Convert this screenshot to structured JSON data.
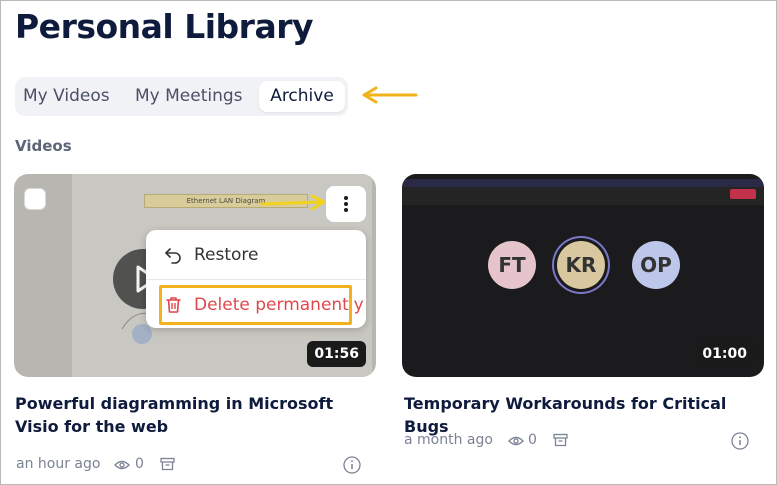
{
  "page": {
    "title": "Personal Library",
    "section_label": "Videos"
  },
  "tabs": [
    {
      "label": "My Videos",
      "active": false
    },
    {
      "label": "My Meetings",
      "active": false
    },
    {
      "label": "Archive",
      "active": true
    }
  ],
  "videos": [
    {
      "title": "Powerful diagramming in Microsoft Visio for the web",
      "duration": "01:56",
      "time_ago": "an hour ago",
      "views": "0",
      "slide_banner": "Ethernet LAN Diagram"
    },
    {
      "title": "Temporary Workarounds for Critical Bugs",
      "duration": "01:00",
      "time_ago": "a month ago",
      "views": "0",
      "participants": [
        {
          "initials": "FT",
          "color": "#e6c4cc"
        },
        {
          "initials": "KR",
          "color": "#d9c89f"
        },
        {
          "initials": "OP",
          "color": "#bcc7ea"
        }
      ]
    }
  ],
  "context_menu": {
    "restore_label": "Restore",
    "delete_label": "Delete permanently",
    "restore_icon": "undo-icon",
    "delete_icon": "trash-icon"
  },
  "colors": {
    "annotation_arrow": "#f1b31c",
    "danger": "#e0474c",
    "title": "#0f1b3d"
  }
}
